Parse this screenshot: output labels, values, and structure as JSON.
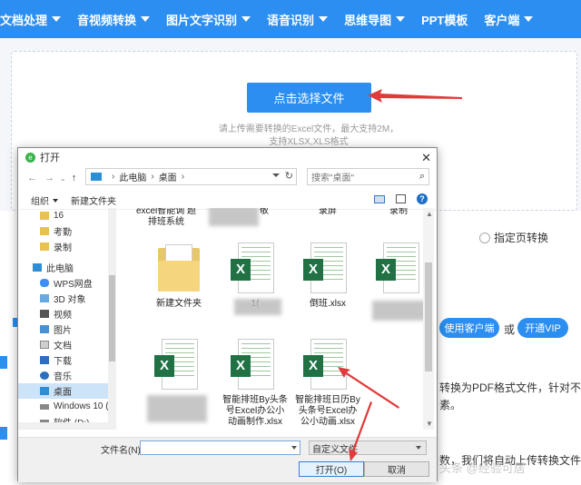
{
  "nav": {
    "items": [
      {
        "label": "文档处理",
        "has_caret": true
      },
      {
        "label": "音视频转换",
        "has_caret": true
      },
      {
        "label": "图片文字识别",
        "has_caret": true
      },
      {
        "label": "语音识别",
        "has_caret": true
      },
      {
        "label": "思维导图",
        "has_caret": true
      },
      {
        "label": "PPT模板",
        "has_caret": false
      },
      {
        "label": "客户端",
        "has_caret": true
      }
    ]
  },
  "upload": {
    "button_label": "点击选择文件",
    "hint_line1": "请上传需要转换的Excel文件，最大支持2M，",
    "hint_line2": "支持XLSX,XLS格式"
  },
  "options": {
    "specified_page_label": "指定页转换"
  },
  "promo": {
    "client_button": "使用客户端",
    "or_text": "或",
    "vip_button": "开通VIP",
    "desc_line1": "转换为PDF格式文件，针对不同版",
    "desc_line2": "素。",
    "desc_line3": "数，我们将自动上传转换文件",
    "watermark": "头条 @经验可居"
  },
  "dialog": {
    "title": "打开",
    "address": {
      "root": "此电脑",
      "current": "桌面"
    },
    "search_placeholder": "搜索\"桌面\"",
    "toolbar": {
      "organize": "组织",
      "new_folder": "新建文件夹"
    },
    "sidebar": [
      {
        "label": "16",
        "icon": "folder-icon",
        "selected": false
      },
      {
        "label": "考勤",
        "icon": "folder-icon",
        "selected": false
      },
      {
        "label": "录制",
        "icon": "folder-icon",
        "selected": false
      },
      {
        "label": "此电脑",
        "icon": "computer-icon",
        "selected": false
      },
      {
        "label": "WPS网盘",
        "icon": "cloud-icon",
        "selected": false
      },
      {
        "label": "3D 对象",
        "icon": "cube-icon",
        "selected": false
      },
      {
        "label": "视频",
        "icon": "video-icon",
        "selected": false
      },
      {
        "label": "图片",
        "icon": "picture-icon",
        "selected": false
      },
      {
        "label": "文档",
        "icon": "document-icon",
        "selected": false
      },
      {
        "label": "下载",
        "icon": "download-icon",
        "selected": false
      },
      {
        "label": "音乐",
        "icon": "music-icon",
        "selected": false
      },
      {
        "label": "桌面",
        "icon": "desktop-icon",
        "selected": true
      },
      {
        "label": "Windows 10 (C",
        "icon": "drive-icon",
        "selected": false
      },
      {
        "label": "软件 (D:)",
        "icon": "drive-icon",
        "selected": false
      }
    ],
    "files_top_row": [
      {
        "label": "excel智能调 题排班系统"
      },
      {
        "label": "敬"
      },
      {
        "label": "录屏"
      },
      {
        "label": "录制"
      }
    ],
    "files": [
      {
        "label": "新建文件夹",
        "type": "folder"
      },
      {
        "label": "1(",
        "type": "excel",
        "blurred": true
      },
      {
        "label": "倒班.xlsx",
        "type": "excel"
      },
      {
        "label": "",
        "type": "excel",
        "blurred": true
      },
      {
        "label": "",
        "type": "excel",
        "blurred": true
      },
      {
        "label": "智能排班By头条号Excel办公小动画制作.xlsx",
        "type": "excel"
      },
      {
        "label": "智能排班日历By头条号Excel办公小动画.xlsx",
        "type": "excel"
      }
    ],
    "filename_label": "文件名(N):",
    "filename_value": "",
    "filetype_value": "自定义文件",
    "open_button": "打开(O)",
    "cancel_button": "取消"
  },
  "colors": {
    "accent": "#2b8ef0",
    "arrow": "#e03a3a",
    "excel": "#207245"
  }
}
